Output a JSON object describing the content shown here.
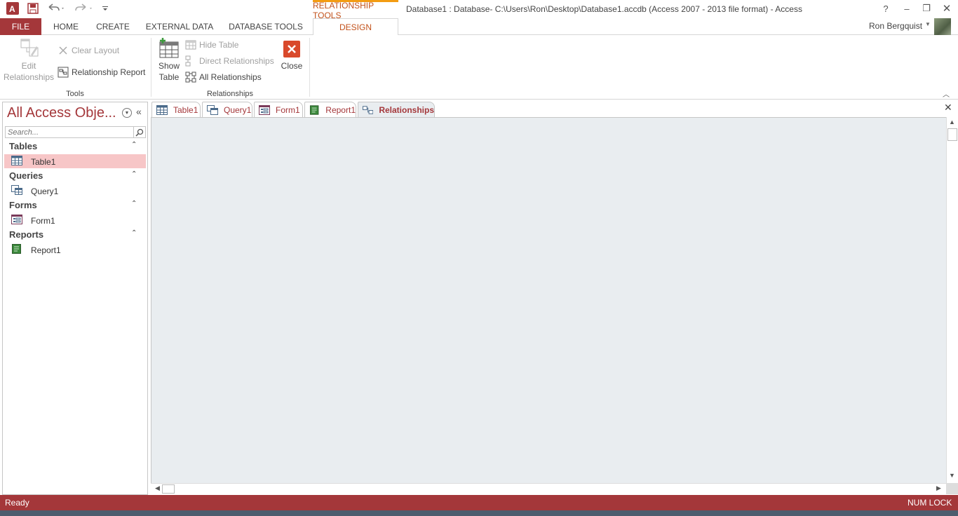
{
  "titlebar": {
    "context_tab_header": "RELATIONSHIP TOOLS",
    "window_title": "Database1 : Database- C:\\Users\\Ron\\Desktop\\Database1.accdb (Access 2007 - 2013 file format) - Access",
    "app_logo_text": "A",
    "help": "?",
    "minimize": "–",
    "restore": "❐",
    "close": "✕"
  },
  "ribbon_tabs": {
    "file": "FILE",
    "home": "HOME",
    "create": "CREATE",
    "external_data": "EXTERNAL DATA",
    "database_tools": "DATABASE TOOLS",
    "design": "DESIGN"
  },
  "user": {
    "name": "Ron Bergquist"
  },
  "ribbon": {
    "tools_group": {
      "label": "Tools",
      "edit_relationships_line1": "Edit",
      "edit_relationships_line2": "Relationships",
      "clear_layout": "Clear Layout",
      "relationship_report": "Relationship Report"
    },
    "relationships_group": {
      "label": "Relationships",
      "show_table_line1": "Show",
      "show_table_line2": "Table",
      "hide_table": "Hide Table",
      "direct_relationships": "Direct Relationships",
      "all_relationships": "All Relationships",
      "close": "Close"
    },
    "close_icon_color": "#d9492b"
  },
  "nav_pane": {
    "title": "All Access Obje...",
    "search_placeholder": "Search...",
    "groups": [
      {
        "label": "Tables",
        "items": [
          {
            "label": "Table1",
            "icon": "table-icon",
            "selected": true
          }
        ]
      },
      {
        "label": "Queries",
        "items": [
          {
            "label": "Query1",
            "icon": "query-icon"
          }
        ]
      },
      {
        "label": "Forms",
        "items": [
          {
            "label": "Form1",
            "icon": "form-icon"
          }
        ]
      },
      {
        "label": "Reports",
        "items": [
          {
            "label": "Report1",
            "icon": "report-icon"
          }
        ]
      }
    ]
  },
  "doc_tabs": [
    {
      "label": "Table1",
      "icon": "table-icon"
    },
    {
      "label": "Query1",
      "icon": "query-icon"
    },
    {
      "label": "Form1",
      "icon": "form-icon"
    },
    {
      "label": "Report1",
      "icon": "report-icon"
    },
    {
      "label": "Relationships",
      "icon": "relationships-icon",
      "active": true
    }
  ],
  "status": {
    "left": "Ready",
    "right": "NUM LOCK"
  },
  "colors": {
    "accent": "#a4373a",
    "context_tab": "#c2511a",
    "canvas": "#e9edf0",
    "selected_item": "#f7c6c7"
  }
}
